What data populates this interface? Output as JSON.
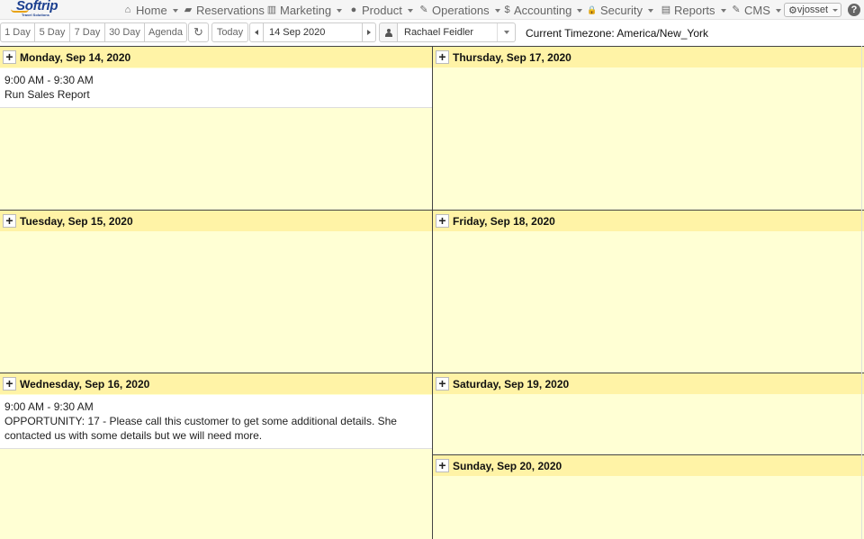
{
  "logo": {
    "name": "Softrip",
    "tagline": "Travel Solutions"
  },
  "nav": [
    {
      "label": "Home",
      "icon": "home-icon",
      "glyph": "⌂",
      "dropdown": true
    },
    {
      "label": "Reservations",
      "icon": "book-icon",
      "glyph": "▰",
      "dropdown": false
    },
    {
      "label": "Marketing",
      "icon": "bar-chart-icon",
      "glyph": "▥",
      "dropdown": true
    },
    {
      "label": "Product",
      "icon": "globe-icon",
      "glyph": "●",
      "dropdown": true
    },
    {
      "label": "Operations",
      "icon": "wrench-icon",
      "glyph": "✎",
      "dropdown": true
    },
    {
      "label": "Accounting",
      "icon": "dollar-icon",
      "glyph": "$",
      "dropdown": true
    },
    {
      "label": "Security",
      "icon": "lock-icon",
      "glyph": "🔒",
      "dropdown": true
    },
    {
      "label": "Reports",
      "icon": "file-icon",
      "glyph": "▤",
      "dropdown": true
    },
    {
      "label": "CMS",
      "icon": "edit-icon",
      "glyph": "✎",
      "dropdown": true
    }
  ],
  "user_menu": {
    "label": "vjosset",
    "glyph": "⚙"
  },
  "help": {
    "glyph": "?"
  },
  "toolbar": {
    "views": [
      "1 Day",
      "5 Day",
      "7 Day",
      "30 Day",
      "Agenda"
    ],
    "refresh_glyph": "↻",
    "today_label": "Today",
    "date_value": "14 Sep 2020",
    "agent_value": "Rachael Feidler",
    "timezone_label": "Current Timezone:",
    "timezone_value": "America/New_York"
  },
  "days": [
    {
      "title": "Monday, Sep 14, 2020",
      "add_glyph": "+",
      "events": [
        {
          "time": "9:00 AM - 9:30 AM",
          "text": "Run Sales Report"
        }
      ]
    },
    {
      "title": "Tuesday, Sep 15, 2020",
      "add_glyph": "+",
      "events": []
    },
    {
      "title": "Wednesday, Sep 16, 2020",
      "add_glyph": "+",
      "events": [
        {
          "time": "9:00 AM - 9:30 AM",
          "text": "OPPORTUNITY: 17 - Please call this customer to get some additional details. She contacted us with some details but we will need more."
        }
      ]
    },
    {
      "title": "Thursday, Sep 17, 2020",
      "add_glyph": "+",
      "events": []
    },
    {
      "title": "Friday, Sep 18, 2020",
      "add_glyph": "+",
      "events": []
    },
    {
      "title": "Saturday, Sep 19, 2020",
      "add_glyph": "+",
      "events": []
    },
    {
      "title": "Sunday, Sep 20, 2020",
      "add_glyph": "+",
      "events": []
    }
  ]
}
